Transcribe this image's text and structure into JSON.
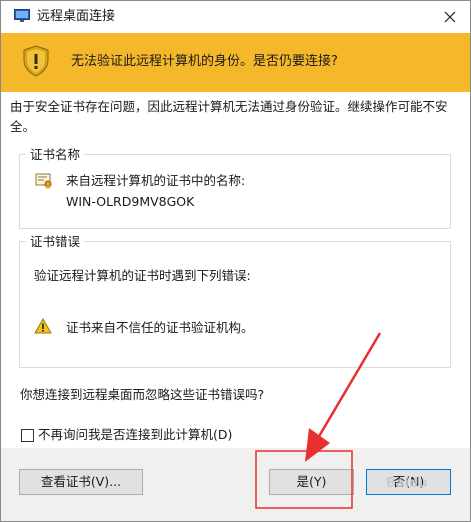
{
  "window": {
    "title": "远程桌面连接"
  },
  "banner": {
    "text": "无法验证此远程计算机的身份。是否仍要连接?",
    "color": "#f6b82b"
  },
  "description": "由于安全证书存在问题，因此远程计算机无法通过身份验证。继续操作可能不安全。",
  "cert_name_group": {
    "label": "证书名称",
    "from_text": "来自远程计算机的证书中的名称:",
    "host": "WIN-OLRD9MV8GOK"
  },
  "cert_error_group": {
    "label": "证书错误",
    "intro": "验证远程计算机的证书时遇到下列错误:",
    "errors": [
      "证书来自不信任的证书验证机构。"
    ]
  },
  "question": "你想连接到远程桌面而忽略这些证书错误吗?",
  "checkbox": {
    "label": "不再询问我是否连接到此计算机(D)",
    "checked": false
  },
  "buttons": {
    "view_cert": "查看证书(V)...",
    "yes": "是(Y)",
    "no": "否(N)"
  },
  "annotation_color": "#e8312f",
  "accent_color": "#0078d7",
  "watermark": "Baidu"
}
